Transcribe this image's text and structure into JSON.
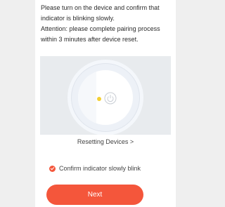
{
  "instructions": {
    "line1": "Please turn on the device and confirm that indicator is blinking slowly.",
    "line2": "Attention: please complete pairing process within 3 minutes after device reset."
  },
  "illustration": {
    "indicator_color": "#f3cf33",
    "icon": "power-icon"
  },
  "reset_link": "Resetting Devices >",
  "confirm": {
    "label": "Confirm indicator slowly blink",
    "checked": true,
    "accent": "#f4563b"
  },
  "next_button": "Next"
}
